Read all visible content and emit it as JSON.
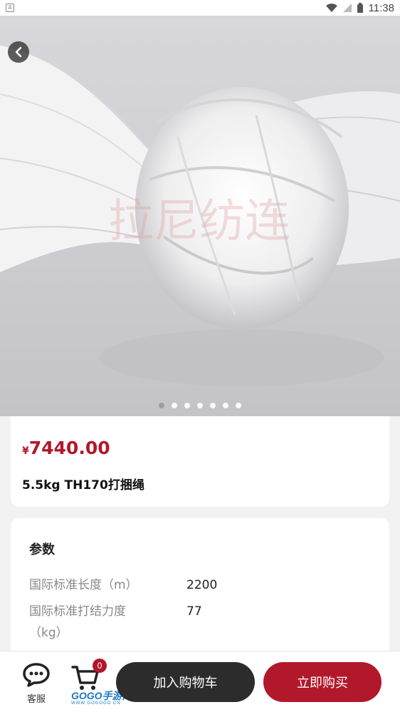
{
  "status_bar": {
    "time": "11:38",
    "app_icon": "A"
  },
  "hero": {
    "image_alt": "white twine rope knot",
    "watermark_text": "拉尼纺连",
    "pager_count": 7,
    "pager_active": 0
  },
  "product": {
    "currency": "¥",
    "price": "7440.00",
    "title": "5.5kg TH170打捆绳"
  },
  "params": {
    "heading": "参数",
    "rows": [
      {
        "label": "国际标准长度（m）",
        "value": "2200"
      },
      {
        "label": "国际标准打结力度（kg）",
        "value": "77"
      }
    ]
  },
  "bottom_bar": {
    "customer_service_label": "客服",
    "cart_count": "0",
    "add_to_cart_label": "加入购物车",
    "buy_now_label": "立即购买",
    "watermark": "GOGO手游网",
    "watermark_url": "WWW.GOGOGO.CN"
  },
  "colors": {
    "accent": "#b2182b",
    "dark_button": "#2c2c2c",
    "background": "#f2f2f2"
  }
}
